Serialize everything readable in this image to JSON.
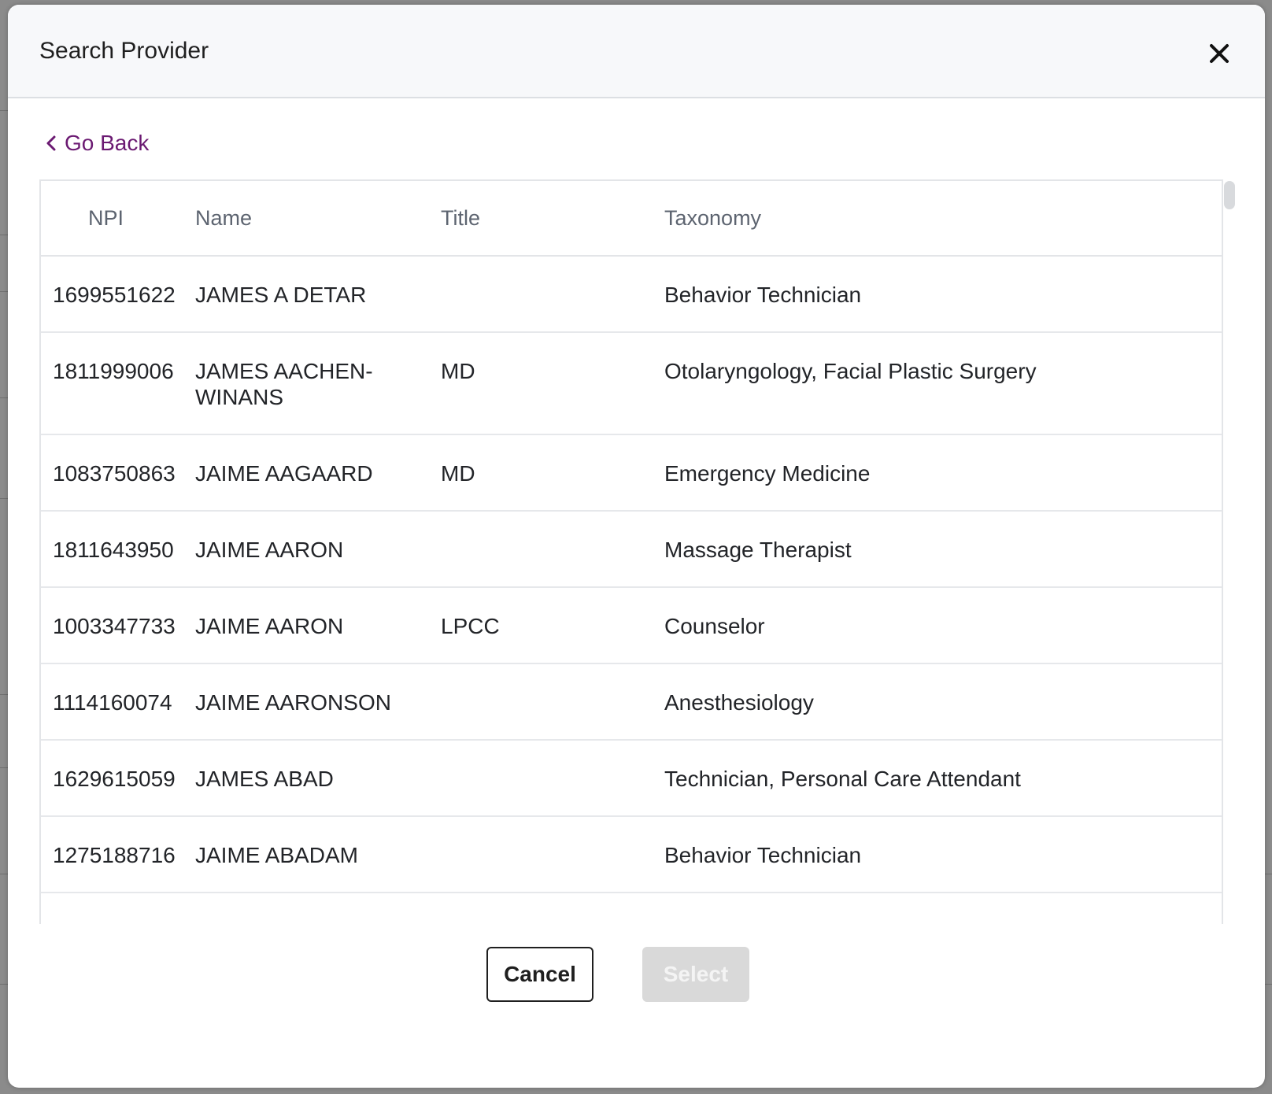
{
  "modal": {
    "title": "Search Provider",
    "go_back_label": "Go Back"
  },
  "table": {
    "columns": [
      "NPI",
      "Name",
      "Title",
      "Taxonomy"
    ],
    "rows": [
      {
        "npi": "1699551622",
        "name": "JAMES A DETAR",
        "title": "",
        "taxonomy": "Behavior Technician"
      },
      {
        "npi": "1811999006",
        "name": "JAMES AACHEN-WINANS",
        "title": "MD",
        "taxonomy": "Otolaryngology, Facial Plastic Surgery"
      },
      {
        "npi": "1083750863",
        "name": "JAIME AAGAARD",
        "title": "MD",
        "taxonomy": "Emergency Medicine"
      },
      {
        "npi": "1811643950",
        "name": "JAIME AARON",
        "title": "",
        "taxonomy": "Massage Therapist"
      },
      {
        "npi": "1003347733",
        "name": "JAIME AARON",
        "title": "LPCC",
        "taxonomy": "Counselor"
      },
      {
        "npi": "1114160074",
        "name": "JAIME AARONSON",
        "title": "",
        "taxonomy": "Anesthesiology"
      },
      {
        "npi": "1629615059",
        "name": "JAMES ABAD",
        "title": "",
        "taxonomy": "Technician, Personal Care Attendant"
      },
      {
        "npi": "1275188716",
        "name": "JAIME ABADAM",
        "title": "",
        "taxonomy": "Behavior Technician"
      }
    ]
  },
  "footer": {
    "cancel_label": "Cancel",
    "select_label": "Select"
  },
  "colors": {
    "accent": "#6b1a72",
    "select_disabled_bg": "#d9d9d9",
    "header_bg": "#f7f8fa"
  },
  "icons": {
    "close": "close-icon",
    "back": "chevron-left-icon"
  }
}
